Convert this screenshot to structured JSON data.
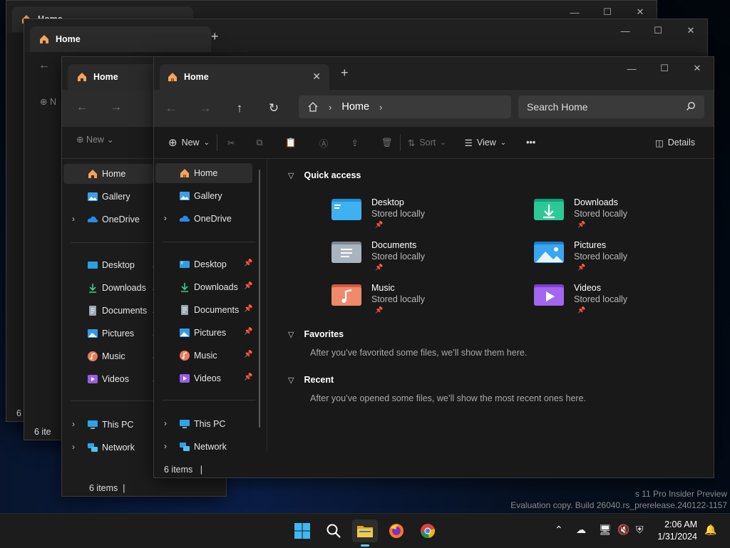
{
  "window": {
    "tab_title": "Home",
    "new_tab": "+",
    "controls": {
      "minimize": "—",
      "maximize": "☐",
      "close": "✕"
    }
  },
  "nav": {
    "breadcrumb_home": "Home",
    "search_placeholder": "Search Home"
  },
  "toolbar": {
    "new_label": "New",
    "sort_label": "Sort",
    "view_label": "View",
    "more_label": "•••",
    "details_label": "Details"
  },
  "sidebar": {
    "items": [
      {
        "label": "Home"
      },
      {
        "label": "Gallery"
      },
      {
        "label": "OneDrive"
      },
      {
        "label": "Desktop"
      },
      {
        "label": "Downloads"
      },
      {
        "label": "Documents"
      },
      {
        "label": "Pictures"
      },
      {
        "label": "Music"
      },
      {
        "label": "Videos"
      },
      {
        "label": "This PC"
      },
      {
        "label": "Network"
      }
    ]
  },
  "content": {
    "quick_access_title": "Quick access",
    "quick_access": [
      {
        "name": "Desktop",
        "sub": "Stored locally"
      },
      {
        "name": "Downloads",
        "sub": "Stored locally"
      },
      {
        "name": "Documents",
        "sub": "Stored locally"
      },
      {
        "name": "Pictures",
        "sub": "Stored locally"
      },
      {
        "name": "Music",
        "sub": "Stored locally"
      },
      {
        "name": "Videos",
        "sub": "Stored locally"
      }
    ],
    "favorites_title": "Favorites",
    "favorites_empty": "After you’ve favorited some files, we’ll show them here.",
    "recent_title": "Recent",
    "recent_empty": "After you’ve opened some files, we’ll show the most recent ones here."
  },
  "status": {
    "items_count": "6 items"
  },
  "background_windows": {
    "tab_title": "Home",
    "new_label": "New",
    "items_count": "6 items",
    "partial_label_1": "N",
    "partial_label_2": "6 i",
    "partial_label_3": "6 ite"
  },
  "taskbar": {
    "time": "2:06 AM",
    "date": "1/31/2024"
  },
  "watermark": {
    "line1": "s 11 Pro Insider Preview",
    "line2": "Evaluation copy. Build 26040.rs_prerelease.240122-1157"
  },
  "colors": {
    "accent": "#60cdff",
    "folder_yellow": "#f0b429"
  }
}
